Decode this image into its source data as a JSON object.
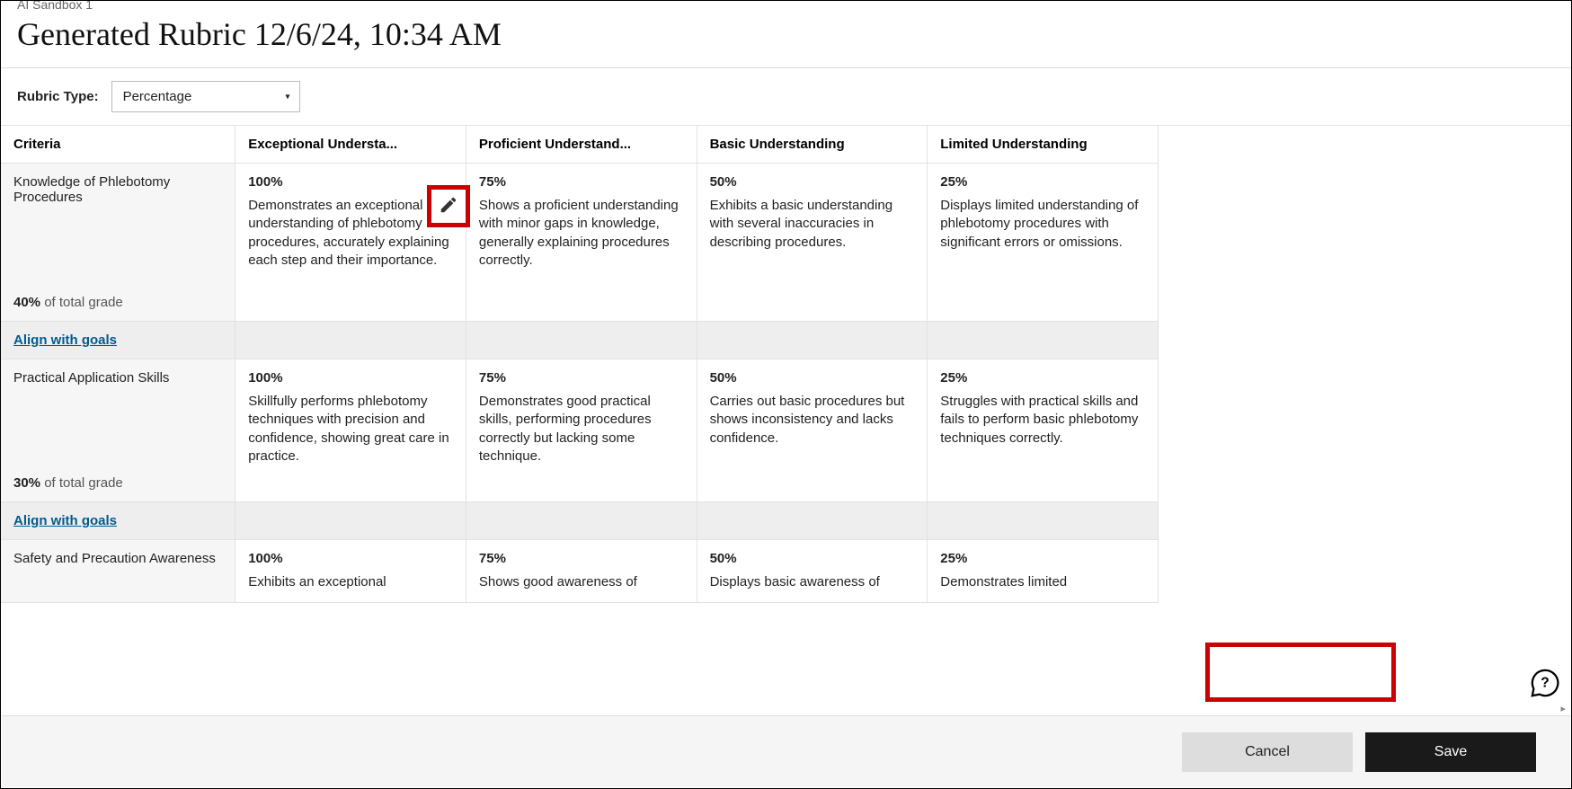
{
  "breadcrumb": "AI Sandbox 1",
  "title": "Generated Rubric 12/6/24, 10:34 AM",
  "rubricTypeLabel": "Rubric Type:",
  "rubricTypeValue": "Percentage",
  "columns": {
    "criteria": "Criteria",
    "levels": [
      "Exceptional Understa...",
      "Proficient Understand...",
      "Basic Understanding",
      "Limited Understanding"
    ]
  },
  "alignLabel": "Align with goals",
  "ofTotalGrade": " of total grade",
  "criteria": [
    {
      "name": "Knowledge of Phlebotomy Procedures",
      "weight": "40%",
      "levels": [
        {
          "pct": "100%",
          "desc": "Demonstrates an exceptional understanding of phlebotomy procedures, accurately explaining each step and their importance."
        },
        {
          "pct": "75%",
          "desc": "Shows a proficient understanding with minor gaps in knowledge, generally explaining procedures correctly."
        },
        {
          "pct": "50%",
          "desc": "Exhibits a basic understanding with several inaccuracies in describing procedures."
        },
        {
          "pct": "25%",
          "desc": "Displays limited understanding of phlebotomy procedures with significant errors or omissions."
        }
      ]
    },
    {
      "name": "Practical Application Skills",
      "weight": "30%",
      "levels": [
        {
          "pct": "100%",
          "desc": "Skillfully performs phlebotomy techniques with precision and confidence, showing great care in practice."
        },
        {
          "pct": "75%",
          "desc": "Demonstrates good practical skills, performing procedures correctly but lacking some technique."
        },
        {
          "pct": "50%",
          "desc": "Carries out basic procedures but shows inconsistency and lacks confidence."
        },
        {
          "pct": "25%",
          "desc": "Struggles with practical skills and fails to perform basic phlebotomy techniques correctly."
        }
      ]
    },
    {
      "name": "Safety and Precaution Awareness",
      "weight": "",
      "levels": [
        {
          "pct": "100%",
          "desc": "Exhibits an exceptional"
        },
        {
          "pct": "75%",
          "desc": "Shows good awareness of"
        },
        {
          "pct": "50%",
          "desc": "Displays basic awareness of"
        },
        {
          "pct": "25%",
          "desc": "Demonstrates limited"
        }
      ]
    }
  ],
  "buttons": {
    "cancel": "Cancel",
    "save": "Save"
  }
}
